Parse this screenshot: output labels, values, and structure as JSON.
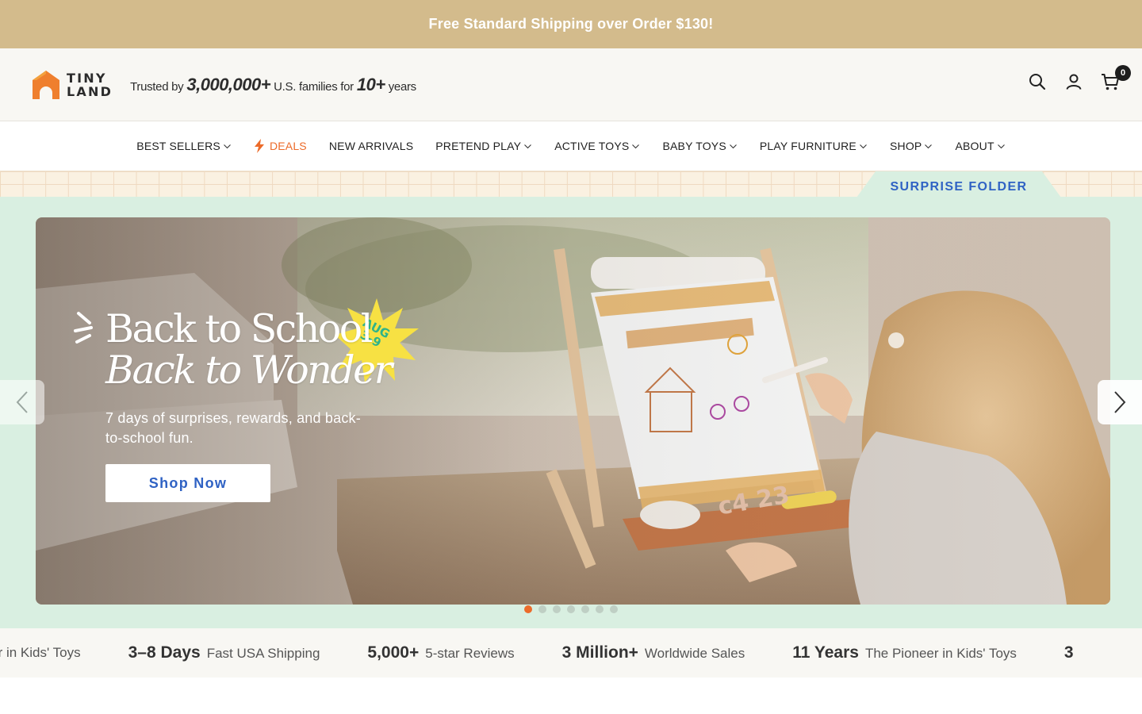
{
  "announcement": {
    "text": "Free Standard Shipping over Order $130!"
  },
  "header": {
    "logo_line1": "TINY",
    "logo_line2": "LAND",
    "trusted_prefix": "Trusted by",
    "trusted_count": "3,000,000+",
    "trusted_middle": "U.S. families for",
    "trusted_years": "10+",
    "trusted_suffix": "years",
    "cart_count": "0",
    "icons": [
      "search-icon",
      "account-icon",
      "cart-icon"
    ]
  },
  "nav": {
    "items": [
      {
        "label": "BEST SELLERS",
        "dropdown": true
      },
      {
        "label": "DEALS",
        "dropdown": false,
        "icon": "lightning-icon"
      },
      {
        "label": "NEW ARRIVALS",
        "dropdown": false
      },
      {
        "label": "PRETEND PLAY",
        "dropdown": true
      },
      {
        "label": "ACTIVE TOYS",
        "dropdown": true
      },
      {
        "label": "BABY TOYS",
        "dropdown": true
      },
      {
        "label": "PLAY FURNITURE",
        "dropdown": true
      },
      {
        "label": "SHOP",
        "dropdown": true
      },
      {
        "label": "ABOUT",
        "dropdown": true
      }
    ]
  },
  "folder": {
    "label": "SURPRISE FOLDER"
  },
  "hero": {
    "headline_line1": "Back to School",
    "headline_line2": "Back to Wonder",
    "badge_line1": "AUG",
    "badge_line2": "3-9",
    "subcopy": "7 days of surprises, rewards, and back-to-school fun.",
    "cta_label": "Shop Now",
    "slide_count": 7,
    "active_slide": 1
  },
  "stats": [
    {
      "num": "",
      "label": "ioneer in Kids' Toys"
    },
    {
      "num": "3–8 Days",
      "label": "Fast USA Shipping"
    },
    {
      "num": "5,000+",
      "label": "5-star Reviews"
    },
    {
      "num": "3 Million+",
      "label": "Worldwide Sales"
    },
    {
      "num": "11 Years",
      "label": "The Pioneer in Kids' Toys"
    },
    {
      "num": "3",
      "label": ""
    }
  ],
  "colors": {
    "announcement_bg": "#d3bb8c",
    "accent_orange": "#ec6b2a",
    "mint_bg": "#d9efe1",
    "link_blue": "#2f62c4"
  }
}
